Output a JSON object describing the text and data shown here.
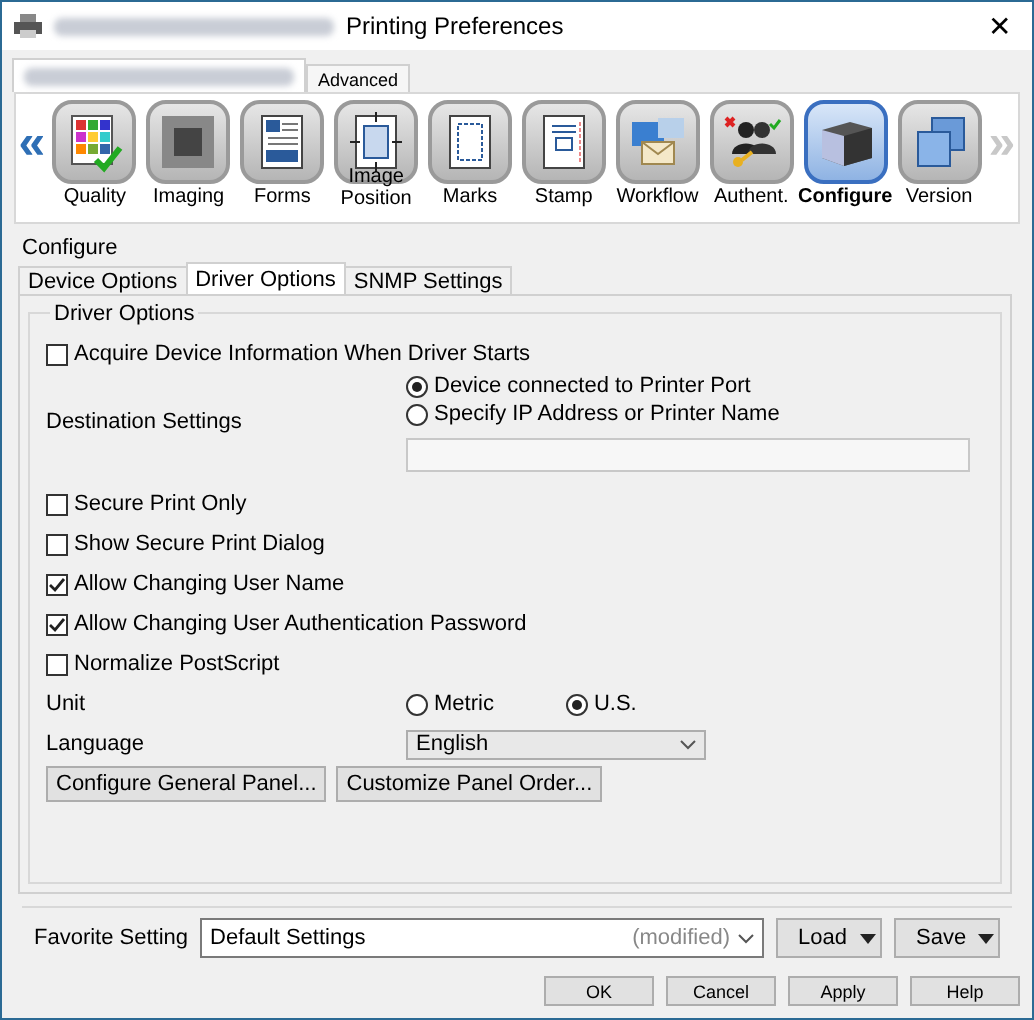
{
  "window": {
    "title": "Printing Preferences",
    "close": "✕"
  },
  "top_tabs": [
    {
      "selected": true
    },
    {
      "label": "Advanced",
      "selected": false
    }
  ],
  "toolbar": {
    "prev": "«",
    "next": "»",
    "items": [
      {
        "label": "Quality",
        "selected": false
      },
      {
        "label": "Imaging",
        "selected": false
      },
      {
        "label": "Forms",
        "selected": false
      },
      {
        "label": "Image Position",
        "selected": false
      },
      {
        "label": "Marks",
        "selected": false
      },
      {
        "label": "Stamp",
        "selected": false
      },
      {
        "label": "Workflow",
        "selected": false
      },
      {
        "label": "Authent.",
        "selected": false
      },
      {
        "label": "Configure",
        "selected": true
      },
      {
        "label": "Version",
        "selected": false
      }
    ]
  },
  "group": {
    "title": "Configure",
    "tabs": [
      {
        "label": "Device Options",
        "selected": false
      },
      {
        "label": "Driver Options",
        "selected": true
      },
      {
        "label": "SNMP Settings",
        "selected": false
      }
    ],
    "section": "Driver Options",
    "rows": [
      {
        "kind": "checkbox",
        "label": "Acquire Device Information When Driver Starts",
        "checked": false
      },
      {
        "kind": "radio-field",
        "label": "Destination Settings",
        "options": [
          {
            "label": "Device connected to Printer Port",
            "selected": true
          },
          {
            "label": "Specify IP Address or Printer Name",
            "selected": false
          }
        ]
      },
      {
        "kind": "checkbox",
        "label": "Secure Print Only",
        "checked": false
      },
      {
        "kind": "checkbox",
        "label": "Show Secure Print Dialog",
        "checked": false
      },
      {
        "kind": "checkbox",
        "label": "Allow Changing User Name",
        "checked": true
      },
      {
        "kind": "checkbox",
        "label": "Allow Changing User Authentication Password",
        "checked": true
      },
      {
        "kind": "checkbox",
        "label": "Normalize PostScript",
        "checked": false
      },
      {
        "kind": "radio",
        "label": "Unit",
        "options": [
          {
            "label": "Metric",
            "selected": false
          },
          {
            "label": "U.S.",
            "selected": true
          }
        ]
      },
      {
        "kind": "select",
        "label": "Language",
        "value": "English"
      },
      {
        "kind": "buttons",
        "buttons": [
          "Configure General Panel...",
          "Customize Panel Order..."
        ]
      }
    ]
  },
  "favorite": {
    "label": "Favorite Setting",
    "value": "Default Settings",
    "note": "(modified)",
    "buttons": [
      "Load",
      "Save"
    ]
  },
  "buttons": [
    "OK",
    "Cancel",
    "Apply",
    "Help"
  ]
}
